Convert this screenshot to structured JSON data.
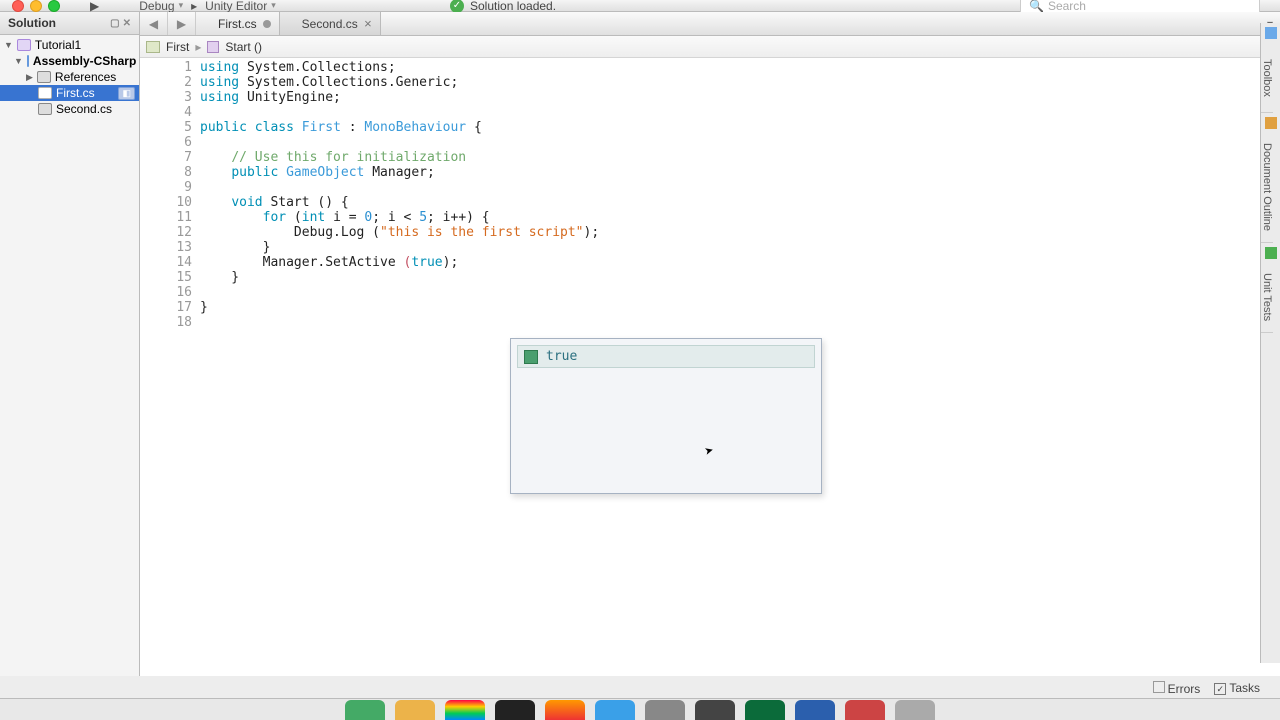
{
  "toolbar": {
    "config1": "Debug",
    "config2": "Unity Editor",
    "status": "Solution loaded.",
    "search_placeholder": "Search"
  },
  "sidebar": {
    "title": "Solution",
    "root": "Tutorial1",
    "proj": "Assembly-CSharp",
    "refs": "References",
    "files": [
      "First.cs",
      "Second.cs"
    ]
  },
  "tabs": [
    {
      "label": "First.cs",
      "dirty": true,
      "active": true
    },
    {
      "label": "Second.cs",
      "dirty": false,
      "active": false
    }
  ],
  "breadcrumb": {
    "item1": "First",
    "item2": "Start ()"
  },
  "code": {
    "lines": [
      {
        "n": 1,
        "html": "<span class='kw'>using</span> System.Collections;"
      },
      {
        "n": 2,
        "html": "<span class='kw'>using</span> System.Collections.Generic;"
      },
      {
        "n": 3,
        "html": "<span class='kw'>using</span> UnityEngine;"
      },
      {
        "n": 4,
        "html": ""
      },
      {
        "n": 5,
        "html": "<span class='kw'>public</span> <span class='kw'>class</span> <span class='ty'>First</span> : <span class='ty'>MonoBehaviour</span> {"
      },
      {
        "n": 6,
        "html": ""
      },
      {
        "n": 7,
        "html": "    <span class='cm'>// Use this for initialization</span>"
      },
      {
        "n": 8,
        "html": "    <span class='kw'>public</span> <span class='ty'>GameObject</span> Manager;"
      },
      {
        "n": 9,
        "html": ""
      },
      {
        "n": 10,
        "html": "    <span class='kw'>void</span> Start () {"
      },
      {
        "n": 11,
        "html": "        <span class='kw'>for</span> (<span class='kw'>int</span> i = <span class='num'>0</span>; i &lt; <span class='num'>5</span>; i++) {"
      },
      {
        "n": 12,
        "html": "            Debug.Log (<span class='str'>\"this is the first script\"</span>);"
      },
      {
        "n": 13,
        "html": "        }"
      },
      {
        "n": 14,
        "html": "        Manager.SetActive <span class='kw2'>(</span><span class='hi'>true</span>);"
      },
      {
        "n": 15,
        "html": "    }"
      },
      {
        "n": 16,
        "html": ""
      },
      {
        "n": 17,
        "html": "}"
      },
      {
        "n": 18,
        "html": ""
      }
    ]
  },
  "autocomplete": {
    "suggestion": "true"
  },
  "rdock": {
    "items": [
      "Toolbox",
      "Document Outline",
      "Unit Tests"
    ]
  },
  "status": {
    "errors": "Errors",
    "tasks": "Tasks"
  }
}
